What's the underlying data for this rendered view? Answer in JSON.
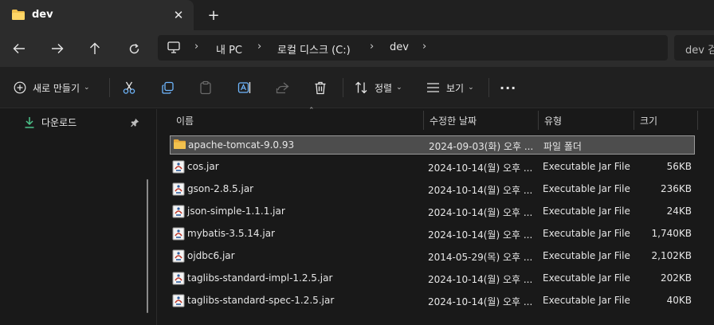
{
  "tab": {
    "title": "dev",
    "close_glyph": "✕",
    "new_glyph": "+"
  },
  "address": {
    "crumbs": [
      "내 PC",
      "로컬 디스크 (C:)",
      "dev"
    ],
    "separator": "›",
    "search_placeholder": "dev 검색"
  },
  "commands": {
    "new_label": "새로 만들기",
    "sort_label": "정렬",
    "view_label": "보기",
    "more_glyph": "···"
  },
  "nav": {
    "quick_item": "다운로드"
  },
  "columns": {
    "name": "이름",
    "date": "수정한 날짜",
    "type": "유형",
    "size": "크기"
  },
  "files": [
    {
      "name": "apache-tomcat-9.0.93",
      "date": "2024-09-03(화) 오후 ...",
      "type": "파일 폴더",
      "size": "",
      "kind": "folder"
    },
    {
      "name": "cos.jar",
      "date": "2024-10-14(월) 오후 ...",
      "type": "Executable Jar File",
      "size": "56KB",
      "kind": "jar"
    },
    {
      "name": "gson-2.8.5.jar",
      "date": "2024-10-14(월) 오후 ...",
      "type": "Executable Jar File",
      "size": "236KB",
      "kind": "jar"
    },
    {
      "name": "json-simple-1.1.1.jar",
      "date": "2024-10-14(월) 오후 ...",
      "type": "Executable Jar File",
      "size": "24KB",
      "kind": "jar"
    },
    {
      "name": "mybatis-3.5.14.jar",
      "date": "2024-10-14(월) 오후 ...",
      "type": "Executable Jar File",
      "size": "1,740KB",
      "kind": "jar"
    },
    {
      "name": "ojdbc6.jar",
      "date": "2014-05-29(목) 오후 ...",
      "type": "Executable Jar File",
      "size": "2,102KB",
      "kind": "jar"
    },
    {
      "name": "taglibs-standard-impl-1.2.5.jar",
      "date": "2024-10-14(월) 오후 ...",
      "type": "Executable Jar File",
      "size": "202KB",
      "kind": "jar"
    },
    {
      "name": "taglibs-standard-spec-1.2.5.jar",
      "date": "2024-10-14(월) 오후 ...",
      "type": "Executable Jar File",
      "size": "40KB",
      "kind": "jar"
    }
  ],
  "colors": {
    "folder": "#f2c14e",
    "accent_green": "#4cc38a",
    "selection": "#4d4d4d"
  }
}
